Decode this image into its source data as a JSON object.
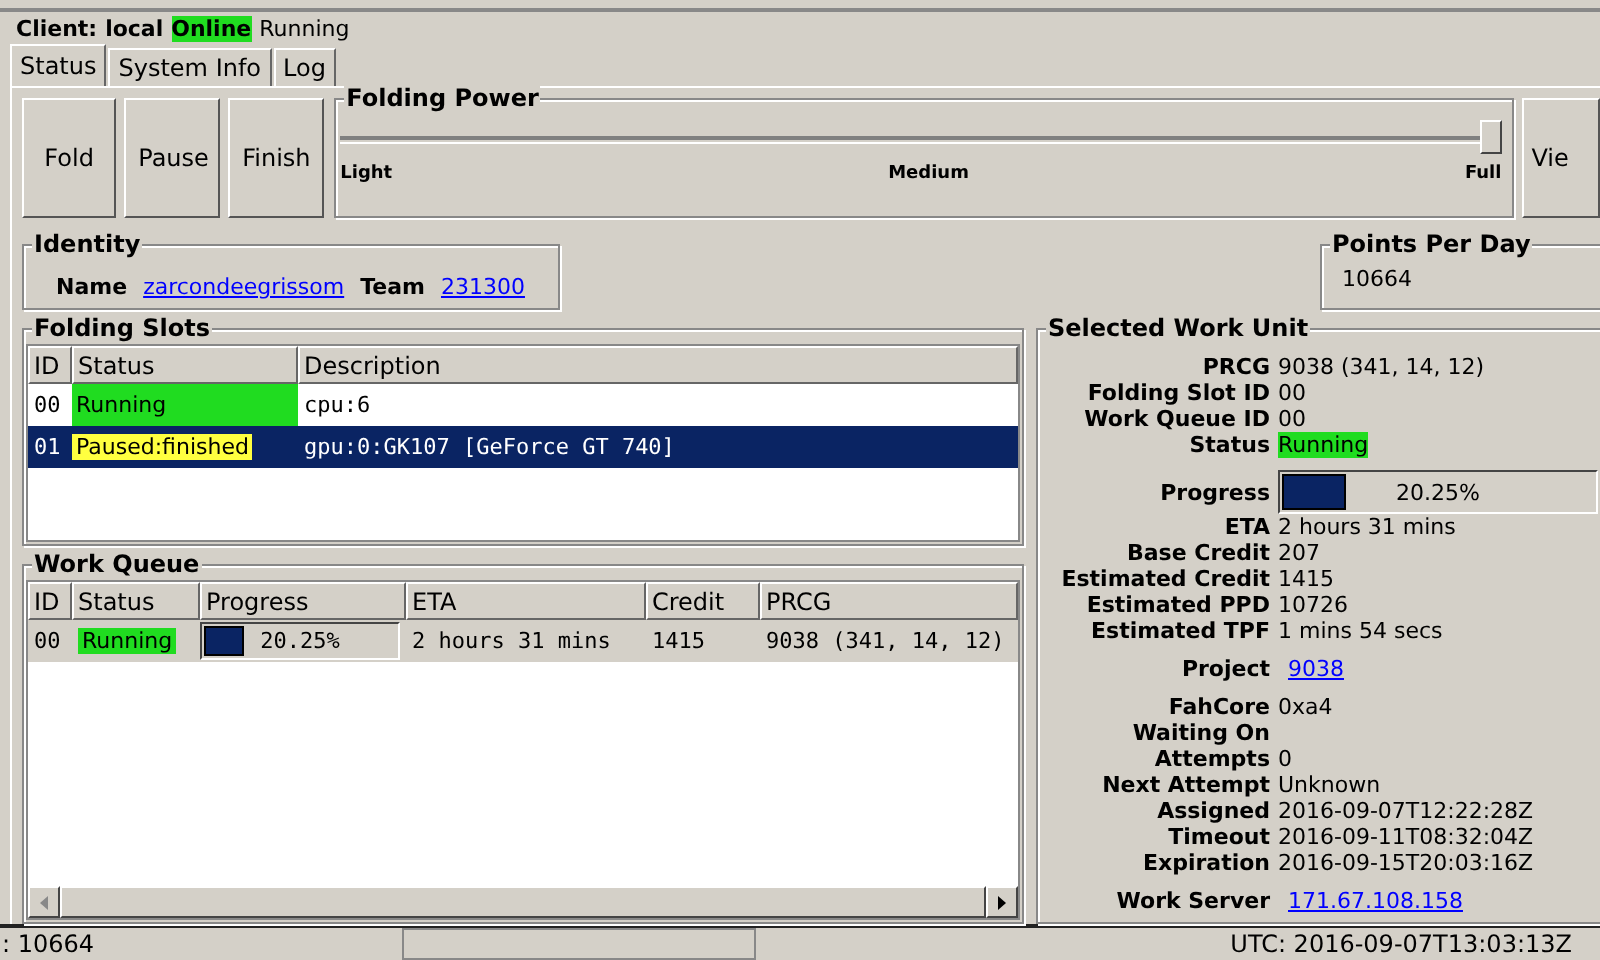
{
  "client": {
    "label": "Client:",
    "name": "local",
    "connection": "Online",
    "state": "Running"
  },
  "tabs": [
    {
      "label": "Status",
      "selected": true
    },
    {
      "label": "System Info",
      "selected": false
    },
    {
      "label": "Log",
      "selected": false
    }
  ],
  "buttons": [
    "Fold",
    "Pause",
    "Finish"
  ],
  "folding_power": {
    "title": "Folding Power",
    "level": 1,
    "ticks": [
      "Light",
      "Medium",
      "Full"
    ]
  },
  "view_button": "Vie",
  "identity": {
    "title": "Identity",
    "name_label": "Name",
    "name": "zarcondeegrissom",
    "team_label": "Team",
    "team": "231300"
  },
  "points_per_day": {
    "title": "Points Per Day",
    "value": "10664"
  },
  "folding_slots": {
    "title": "Folding Slots",
    "columns": [
      "ID",
      "Status",
      "Description"
    ],
    "rows": [
      {
        "id": "00",
        "status": "Running",
        "color": "#20dc20",
        "description": "cpu:6",
        "selected": false
      },
      {
        "id": "01",
        "status": "Paused:finished",
        "color": "#ffff40",
        "description": "gpu:0:GK107 [GeForce GT 740]",
        "selected": true
      }
    ]
  },
  "work_queue": {
    "title": "Work Queue",
    "columns": [
      "ID",
      "Status",
      "Progress",
      "ETA",
      "Credit",
      "PRCG"
    ],
    "rows": [
      {
        "id": "00",
        "status": "Running",
        "color": "#20dc20",
        "level": 0.2025,
        "progress": "20.25%",
        "eta": "2 hours 31 mins",
        "credit": "1415",
        "prcg": "9038 (341, 14, 12)"
      }
    ]
  },
  "selected_work_unit": {
    "title": "Selected Work Unit",
    "fields": [
      {
        "kind": "text",
        "label": "PRCG",
        "value": "9038 (341, 14, 12)"
      },
      {
        "kind": "text",
        "label": "Folding Slot ID",
        "value": "00"
      },
      {
        "kind": "text",
        "label": "Work Queue ID",
        "value": "00"
      },
      {
        "kind": "status",
        "label": "Status",
        "value": "Running",
        "color": "#20dc20"
      },
      {
        "kind": "progress",
        "label": "Progress",
        "value": "20.25%",
        "level": 0.2025
      },
      {
        "kind": "text",
        "label": "ETA",
        "value": "2 hours 31 mins"
      },
      {
        "kind": "text",
        "label": "Base Credit",
        "value": "207"
      },
      {
        "kind": "text",
        "label": "Estimated Credit",
        "value": "1415"
      },
      {
        "kind": "text",
        "label": "Estimated PPD",
        "value": "10726"
      },
      {
        "kind": "text",
        "label": "Estimated TPF",
        "value": "1 mins 54 secs"
      },
      {
        "kind": "link",
        "label": "Project",
        "value": "9038"
      },
      {
        "kind": "text",
        "label": "FahCore",
        "value": "0xa4"
      },
      {
        "kind": "text",
        "label": "Waiting On"
      },
      {
        "kind": "text",
        "label": "Attempts",
        "value": "0"
      },
      {
        "kind": "text",
        "label": "Next Attempt",
        "value": "Unknown"
      },
      {
        "kind": "text",
        "label": "Assigned",
        "value": "2016-09-07T12:22:28Z"
      },
      {
        "kind": "text",
        "label": "Timeout",
        "value": "2016-09-11T08:32:04Z"
      },
      {
        "kind": "text",
        "label": "Expiration",
        "value": "2016-09-15T20:03:16Z"
      },
      {
        "kind": "link",
        "label": "Work Server",
        "value": "171.67.108.158"
      }
    ]
  },
  "status_bar": {
    "points": ": 10664",
    "utc": "UTC: 2016-09-07T13:03:13Z"
  }
}
